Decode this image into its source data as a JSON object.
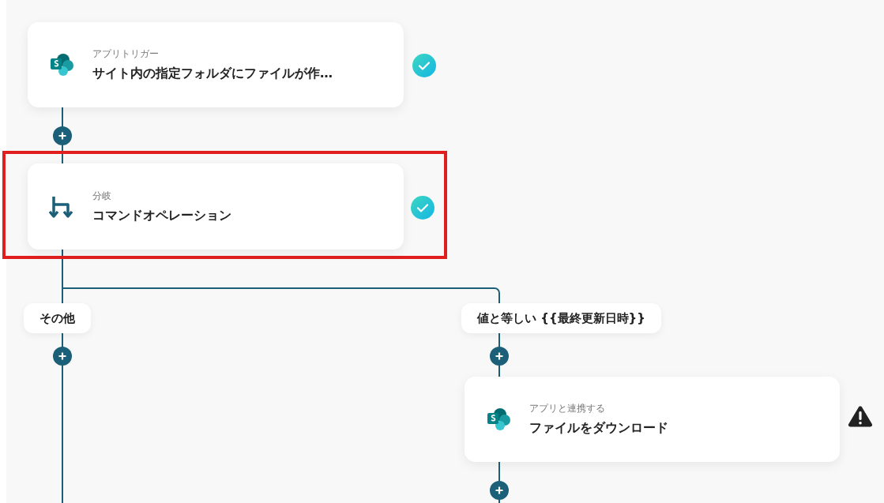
{
  "nodes": [
    {
      "kind": "sharepoint",
      "label": "アプリトリガー",
      "title": "サイト内の指定フォルダにファイルが作…",
      "completed": true,
      "warning": false,
      "highlighted": false
    },
    {
      "kind": "branch",
      "label": "分岐",
      "title": "コマンドオペレーション",
      "completed": true,
      "warning": false,
      "highlighted": true
    },
    {
      "kind": "sharepoint",
      "label": "アプリと連携する",
      "title": "ファイルをダウンロード",
      "completed": false,
      "warning": true,
      "highlighted": false
    }
  ],
  "branches": [
    {
      "label": "その他"
    },
    {
      "label": "値と等しい {{最終更新日時}}"
    }
  ]
}
